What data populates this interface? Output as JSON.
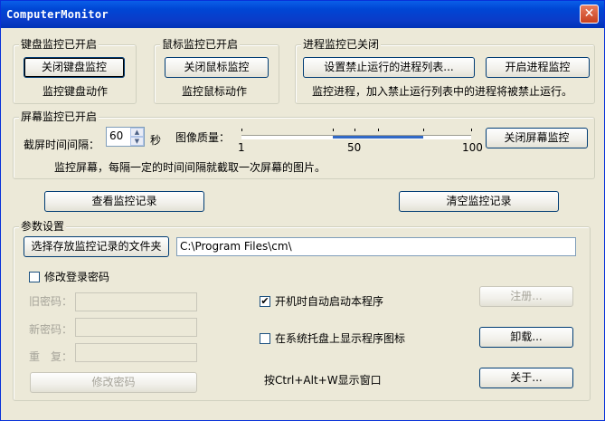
{
  "window": {
    "title": "ComputerMonitor",
    "close_glyph": "✕"
  },
  "keyboard": {
    "group_title": "键盘监控已开启",
    "toggle_label": "关闭键盘监控",
    "status": "监控键盘动作"
  },
  "mouse": {
    "group_title": "鼠标监控已开启",
    "toggle_label": "关闭鼠标监控",
    "status": "监控鼠标动作"
  },
  "process": {
    "group_title": "进程监控已关闭",
    "set_list_label": "设置禁止运行的进程列表...",
    "toggle_label": "开启进程监控",
    "status": "监控进程，加入禁止运行列表中的进程将被禁止运行。"
  },
  "screen": {
    "group_title": "屏幕监控已开启",
    "interval_label": "截屏时间间隔：",
    "interval_value": "60",
    "interval_unit": "秒",
    "quality_label": "图像质量：",
    "quality_value": 50,
    "quality_min_label": "1",
    "quality_mid_label": "50",
    "quality_max_label": "100",
    "toggle_label": "关闭屏幕监控",
    "status": "监控屏幕，每隔一定的时间间隔就截取一次屏幕的图片。"
  },
  "actions": {
    "view_log_label": "查看监控记录",
    "clear_log_label": "清空监控记录"
  },
  "params": {
    "group_title": "参数设置",
    "choose_folder_label": "选择存放监控记录的文件夹",
    "folder_path": "C:\\Program Files\\cm\\",
    "change_password_check_label": "修改登录密码",
    "change_password_checked": false,
    "old_password_label": "旧密码：",
    "new_password_label": "新密码：",
    "repeat_label": "重　复：",
    "change_password_button": "修改密码",
    "autostart_label": "开机时自动启动本程序",
    "autostart_checked": true,
    "tray_icon_label": "在系统托盘上显示程序图标",
    "tray_icon_checked": false,
    "register_label": "注册...",
    "uninstall_label": "卸载...",
    "hotkey_text": "按Ctrl+Alt+W显示窗口",
    "about_label": "关于..."
  },
  "icons": {
    "close": "close-icon",
    "spin_up": "chevron-up-icon",
    "spin_down": "chevron-down-icon",
    "check": "checkmark-icon"
  },
  "colors": {
    "titlebar": "#0046d5",
    "window_bg": "#ece9d8",
    "slider_selection": "#3169c6"
  }
}
